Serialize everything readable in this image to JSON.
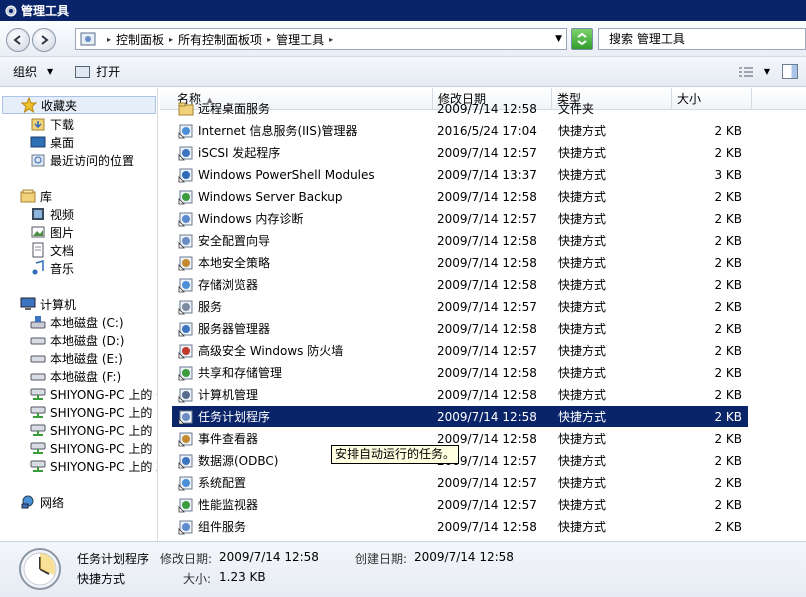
{
  "window": {
    "title": "管理工具"
  },
  "address": {
    "crumbs": [
      "控制面板",
      "所有控制面板项",
      "管理工具"
    ],
    "search_placeholder": "搜索 管理工具"
  },
  "toolbar": {
    "organize": "组织",
    "open": "打开"
  },
  "nav": {
    "favorites": "收藏夹",
    "downloads": "下载",
    "desktop": "桌面",
    "recent": "最近访问的位置",
    "libraries": "库",
    "videos": "视频",
    "pictures": "图片",
    "documents": "文档",
    "music": "音乐",
    "computer": "计算机",
    "drives": [
      "本地磁盘 (C:)",
      "本地磁盘 (D:)",
      "本地磁盘 (E:)",
      "本地磁盘 (F:)"
    ],
    "shares": [
      "SHIYONG-PC 上的 C",
      "SHIYONG-PC 上的 D",
      "SHIYONG-PC 上的 E",
      "SHIYONG-PC 上的 F",
      "SHIYONG-PC 上的 Z"
    ],
    "network": "网络"
  },
  "columns": {
    "name": "名称",
    "date": "修改日期",
    "type": "类型",
    "size": "大小"
  },
  "files": [
    {
      "name": "远程桌面服务",
      "date": "2009/7/14 12:58",
      "type": "文件夹",
      "size": ""
    },
    {
      "name": "Internet 信息服务(IIS)管理器",
      "date": "2016/5/24 17:04",
      "type": "快捷方式",
      "size": "2 KB"
    },
    {
      "name": "iSCSI 发起程序",
      "date": "2009/7/14 12:57",
      "type": "快捷方式",
      "size": "2 KB"
    },
    {
      "name": "Windows PowerShell Modules",
      "date": "2009/7/14 13:37",
      "type": "快捷方式",
      "size": "3 KB"
    },
    {
      "name": "Windows Server Backup",
      "date": "2009/7/14 12:58",
      "type": "快捷方式",
      "size": "2 KB"
    },
    {
      "name": "Windows 内存诊断",
      "date": "2009/7/14 12:57",
      "type": "快捷方式",
      "size": "2 KB"
    },
    {
      "name": "安全配置向导",
      "date": "2009/7/14 12:58",
      "type": "快捷方式",
      "size": "2 KB"
    },
    {
      "name": "本地安全策略",
      "date": "2009/7/14 12:58",
      "type": "快捷方式",
      "size": "2 KB"
    },
    {
      "name": "存储浏览器",
      "date": "2009/7/14 12:58",
      "type": "快捷方式",
      "size": "2 KB"
    },
    {
      "name": "服务",
      "date": "2009/7/14 12:57",
      "type": "快捷方式",
      "size": "2 KB"
    },
    {
      "name": "服务器管理器",
      "date": "2009/7/14 12:58",
      "type": "快捷方式",
      "size": "2 KB"
    },
    {
      "name": "高级安全 Windows 防火墙",
      "date": "2009/7/14 12:57",
      "type": "快捷方式",
      "size": "2 KB"
    },
    {
      "name": "共享和存储管理",
      "date": "2009/7/14 12:58",
      "type": "快捷方式",
      "size": "2 KB"
    },
    {
      "name": "计算机管理",
      "date": "2009/7/14 12:58",
      "type": "快捷方式",
      "size": "2 KB"
    },
    {
      "name": "任务计划程序",
      "date": "2009/7/14 12:58",
      "type": "快捷方式",
      "size": "2 KB"
    },
    {
      "name": "事件查看器",
      "date": "2009/7/14 12:58",
      "type": "快捷方式",
      "size": "2 KB"
    },
    {
      "name": "数据源(ODBC)",
      "date": "2009/7/14 12:57",
      "type": "快捷方式",
      "size": "2 KB"
    },
    {
      "name": "系统配置",
      "date": "2009/7/14 12:57",
      "type": "快捷方式",
      "size": "2 KB"
    },
    {
      "name": "性能监视器",
      "date": "2009/7/14 12:57",
      "type": "快捷方式",
      "size": "2 KB"
    },
    {
      "name": "组件服务",
      "date": "2009/7/14 12:58",
      "type": "快捷方式",
      "size": "2 KB"
    }
  ],
  "tooltip": "安排自动运行的任务。",
  "details": {
    "name": "任务计划程序",
    "modified_label": "修改日期:",
    "modified": "2009/7/14 12:58",
    "created_label": "创建日期:",
    "created": "2009/7/14 12:58",
    "type": "快捷方式",
    "size_label": "大小:",
    "size": "1.23 KB"
  },
  "colors": {
    "selection": "#0a246a",
    "titlebar": "#0a246a",
    "tooltip_bg": "#ffffe1"
  }
}
